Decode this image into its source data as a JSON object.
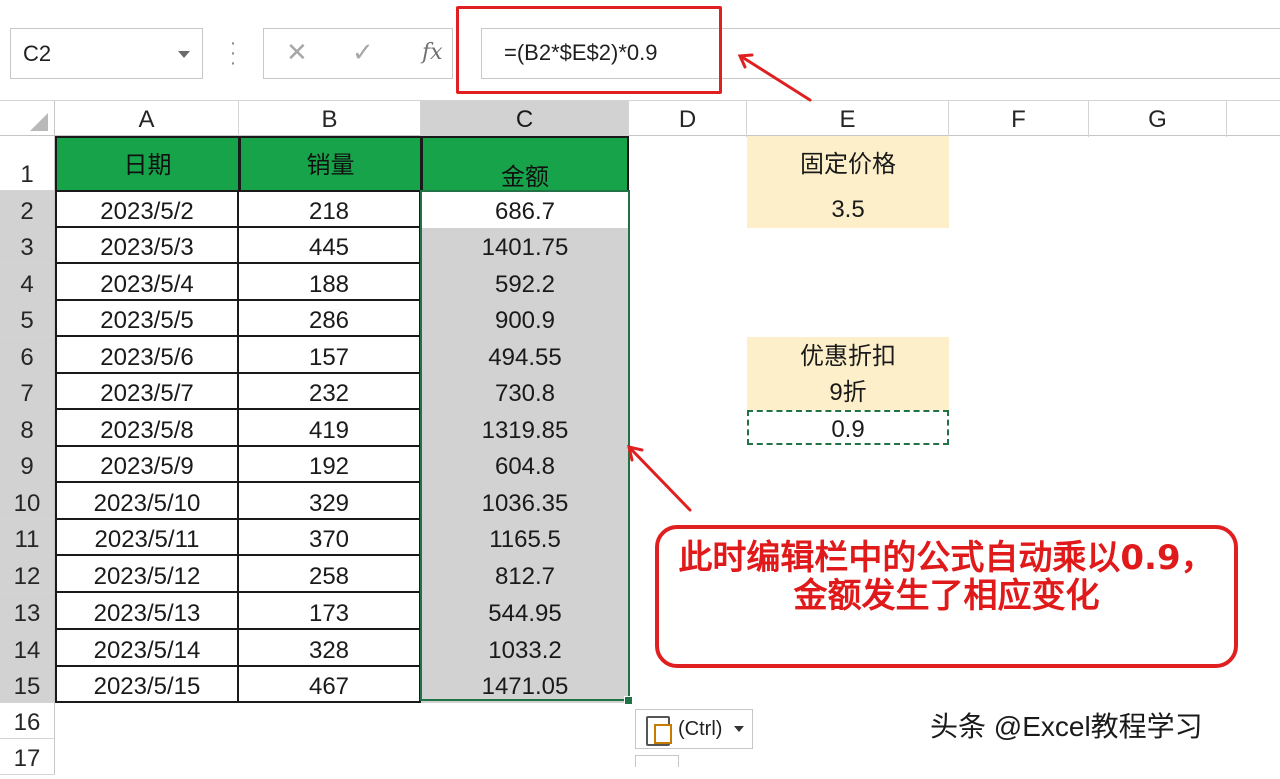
{
  "formula_bar": {
    "name_box": "C2",
    "cancel_icon": "✕",
    "enter_icon": "✓",
    "fx_icon": "fx",
    "formula": "=(B2*$E$2)*0.9"
  },
  "columns": [
    "A",
    "B",
    "C",
    "D",
    "E",
    "F",
    "G"
  ],
  "rows": [
    "1",
    "2",
    "3",
    "4",
    "5",
    "6",
    "7",
    "8",
    "9",
    "10",
    "11",
    "12",
    "13",
    "14",
    "15",
    "16",
    "17"
  ],
  "table": {
    "headers": [
      "日期",
      "销量",
      "金额"
    ],
    "rows": [
      [
        "2023/5/2",
        "218",
        "686.7"
      ],
      [
        "2023/5/3",
        "445",
        "1401.75"
      ],
      [
        "2023/5/4",
        "188",
        "592.2"
      ],
      [
        "2023/5/5",
        "286",
        "900.9"
      ],
      [
        "2023/5/6",
        "157",
        "494.55"
      ],
      [
        "2023/5/7",
        "232",
        "730.8"
      ],
      [
        "2023/5/8",
        "419",
        "1319.85"
      ],
      [
        "2023/5/9",
        "192",
        "604.8"
      ],
      [
        "2023/5/10",
        "329",
        "1036.35"
      ],
      [
        "2023/5/11",
        "370",
        "1165.5"
      ],
      [
        "2023/5/12",
        "258",
        "812.7"
      ],
      [
        "2023/5/13",
        "173",
        "544.95"
      ],
      [
        "2023/5/14",
        "328",
        "1033.2"
      ],
      [
        "2023/5/15",
        "467",
        "1471.05"
      ]
    ]
  },
  "side_panel": {
    "fixed_price_label": "固定价格",
    "fixed_price_value": "3.5",
    "discount_label": "优惠折扣",
    "discount_desc": "9折",
    "discount_value": "0.9"
  },
  "paste_options": {
    "label": "(Ctrl)"
  },
  "callout": {
    "text": "此时编辑栏中的公式自动乘以0.9，金额发生了相应变化"
  },
  "watermark": "头条 @Excel教程学习",
  "colors": {
    "header_green": "#17a34a",
    "selection_green": "#217346",
    "annotation_red": "#e02020",
    "beige": "#fdefc9"
  }
}
